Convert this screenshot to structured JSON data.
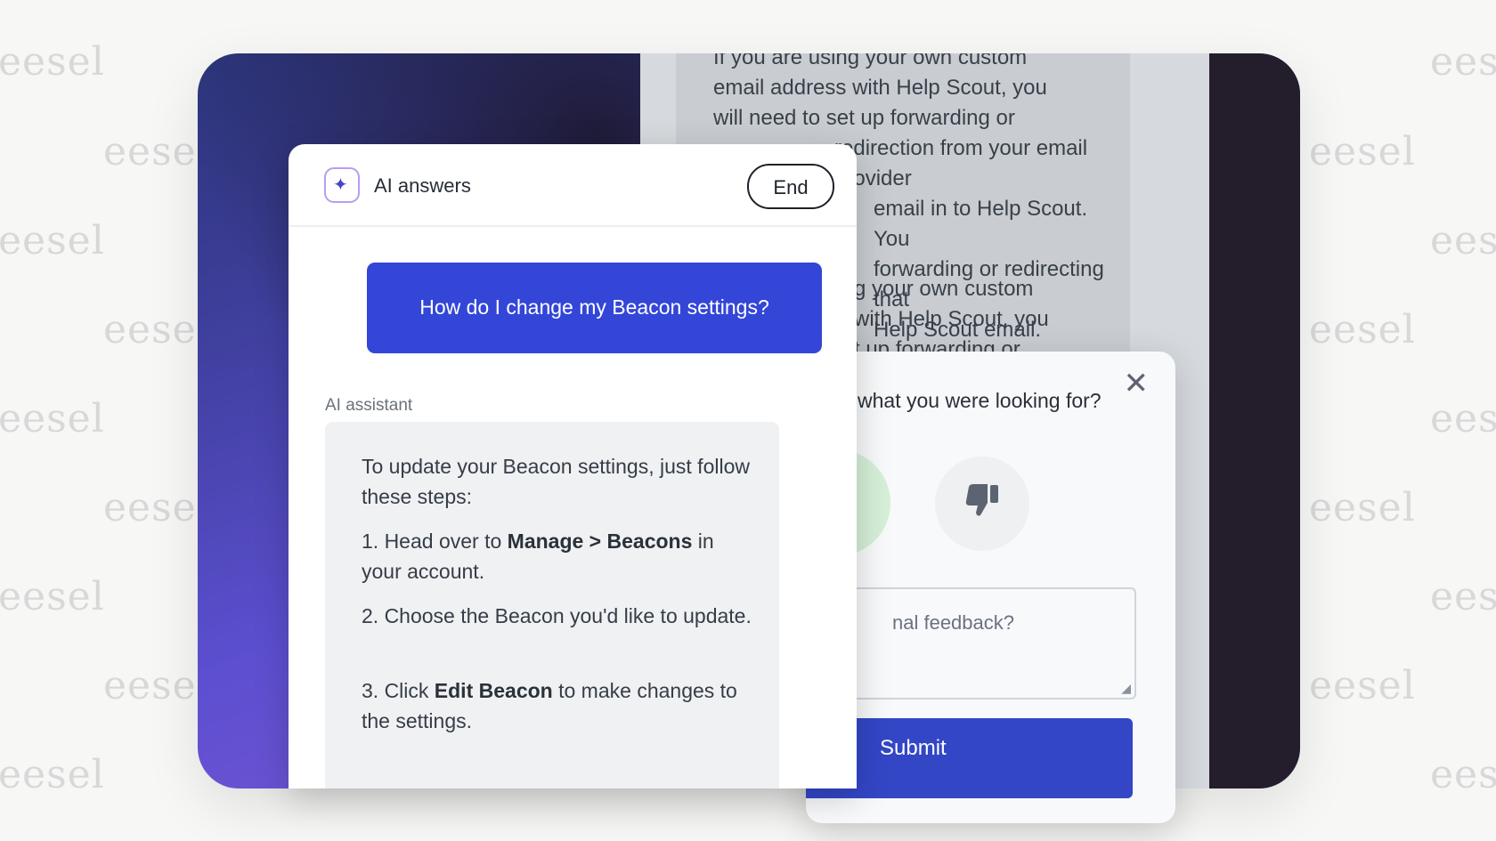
{
  "watermark": "eesel",
  "article": {
    "paragraph1": [
      "If you are using your own custom",
      "email address with Help Scout, you",
      "will need to set up forwarding or",
      "redirection from your email provider",
      "email in to Help Scout. You",
      "forwarding or redirecting that",
      "Help Scout email."
    ],
    "paragraph2": [
      "g your own custom",
      "with Help Scout, you",
      "t up forwarding or"
    ]
  },
  "feedback": {
    "question": "what you were looking for?",
    "close_icon": "close-icon",
    "thumbs_up_icon": "thumbs-up-icon",
    "thumbs_down_icon": "thumbs-down-icon",
    "placeholder": "nal feedback?",
    "submit_label": "Submit",
    "colors": {
      "thumbs_up": "#4caf6e",
      "thumbs_down": "#5b6470",
      "submit": "#3346c6"
    }
  },
  "chat": {
    "icon": "sparkle-icon",
    "title": "AI answers",
    "end_label": "End",
    "user_message": "How do I change my Beacon settings?",
    "assistant_label": "AI assistant",
    "assistant": {
      "intro": "To update your Beacon settings, just follow these steps:",
      "step1_pre": "1. Head over to ",
      "step1_bold": "Manage > Beacons",
      "step1_post": " in your account.",
      "step2": "2. Choose the Beacon you'd like to update.",
      "step3_pre": "3. Click ",
      "step3_bold": "Edit Beacon",
      "step3_post": " to make changes to the settings."
    },
    "colors": {
      "user_bubble": "#3346d8",
      "assistant_bubble": "#eff1f3"
    }
  }
}
